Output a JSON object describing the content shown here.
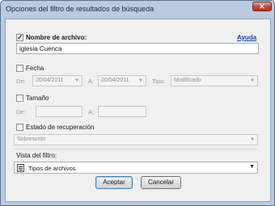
{
  "window": {
    "title": "Opciones del filtro de resultados de búsqueda",
    "close_glyph": "✕"
  },
  "help_link": "Ayuda",
  "filename": {
    "label": "Nombre de archivo:",
    "checked": true,
    "value": "iglesia Cuenca"
  },
  "date": {
    "label": "Fecha",
    "checked": false,
    "from_label": "De:",
    "from_value": "20/04/2011",
    "to_label": "A:",
    "to_value": "20/04/2011",
    "type_label": "Tipo:",
    "type_value": "Modificado"
  },
  "size": {
    "label": "Tamaño",
    "checked": false,
    "from_label": "De:",
    "to_label": "A:"
  },
  "recovery": {
    "label": "Estado de recuperación",
    "checked": false,
    "value": "Sobrescrito"
  },
  "view": {
    "label": "Vista del filtro:",
    "value": "Tipos de archivos",
    "icon": "document-list-icon"
  },
  "buttons": {
    "accept": "Aceptar",
    "cancel": "Cancelar"
  },
  "colors": {
    "window_frame": "#b9cbe0",
    "link": "#0645ad",
    "close_button": "#c6432e"
  }
}
